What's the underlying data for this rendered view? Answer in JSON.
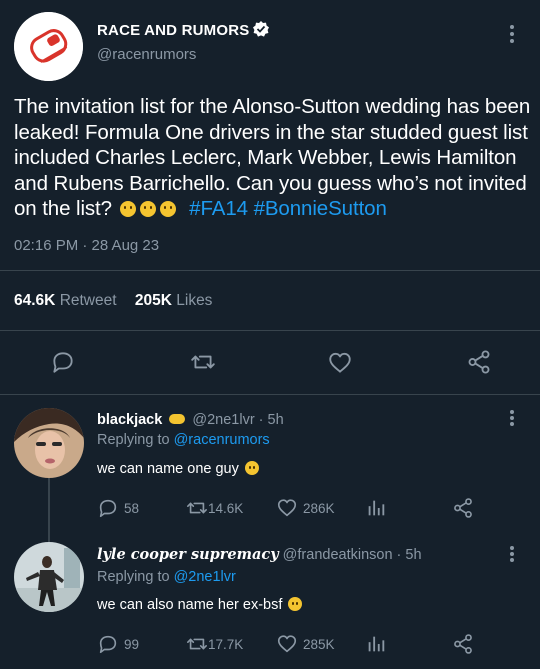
{
  "main_tweet": {
    "display_name": "RACE AND RUMORS",
    "handle": "@racenrumors",
    "text_part1": "The invitation list for the Alonso-Sutton wedding has been leaked! Formula One drivers in the star studded guest list included Charles Leclerc, Mark Webber, Lewis Hamilton and Rubens Barrichello. Can you guess who’s not invited on the list?",
    "hashtags": [
      "#FA14",
      "#BonnieSutton"
    ],
    "timestamp": "02:16 PM · 28 Aug 23",
    "retweets_count": "64.6K",
    "retweets_label": "Retweet",
    "likes_count": "205K",
    "likes_label": "Likes"
  },
  "replies": [
    {
      "display_name": "blackjack",
      "handle_time": "@2ne1lvr · 5h",
      "replying_label": "Replying to",
      "replying_to": "@racenrumors",
      "text": "we can name one guy",
      "comments": "58",
      "retweets": "14.6K",
      "likes": "286K"
    },
    {
      "display_name": "lyle cooper supremacy",
      "handle_time": "@frandeatkinson · 5h",
      "replying_label": "Replying to",
      "replying_to": "@2ne1lvr",
      "text": "we can also name her ex-bsf",
      "comments": "99",
      "retweets": "17.7K",
      "likes": "285K"
    }
  ],
  "colors": {
    "background": "#15202b",
    "accent": "#1d9bf0",
    "muted": "#8b98a5",
    "divider": "#38444d"
  }
}
